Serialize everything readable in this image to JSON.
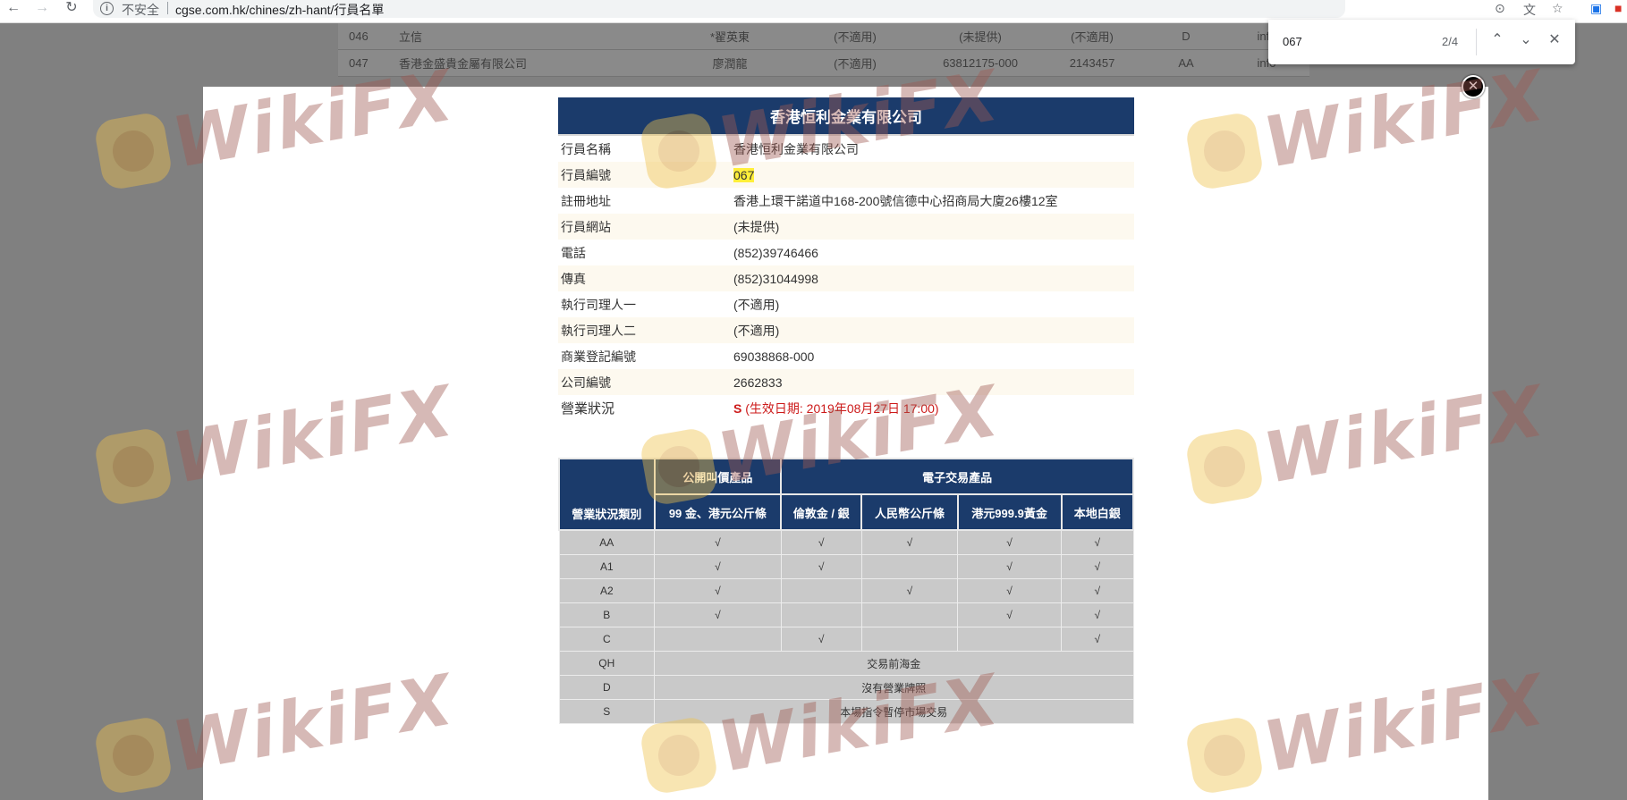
{
  "browser": {
    "security_label": "不安全",
    "url": "cgse.com.hk/chines/zh-hant/行員名單"
  },
  "background_rows": [
    {
      "no": "046",
      "name": "立信",
      "contact": "*翟英東",
      "c1": "(不適用)",
      "c2": "(未提供)",
      "c3": "(不適用)",
      "cat": "D",
      "link": "info"
    },
    {
      "no": "047",
      "name": "香港金盛貴金屬有限公司",
      "contact": "廖潤龍",
      "c1": "(不適用)",
      "c2": "63812175-000",
      "c3": "2143457",
      "cat": "AA",
      "link": "info"
    }
  ],
  "find_bar": {
    "query": "067",
    "count": "2/4"
  },
  "member": {
    "title": "香港恒利金業有限公司",
    "fields": [
      {
        "label": "行員名稱",
        "value": "香港恒利金業有限公司"
      },
      {
        "label": "行員編號",
        "value": "067"
      },
      {
        "label": "註冊地址",
        "value": "香港上環干諾道中168-200號信德中心招商局大廈26樓12室"
      },
      {
        "label": "行員網站",
        "value": "(未提供)"
      },
      {
        "label": "電話",
        "value": "(852)39746466"
      },
      {
        "label": "傳真",
        "value": "(852)31044998"
      },
      {
        "label": "執行司理人一",
        "value": "(不適用)"
      },
      {
        "label": "執行司理人二",
        "value": "(不適用)"
      },
      {
        "label": "商業登記編號",
        "value": "69038868-000"
      },
      {
        "label": "公司編號",
        "value": "2662833"
      }
    ],
    "status_label": "營業狀況",
    "status_code": "S",
    "status_detail": "(生效日期: 2019年08月27日 17:00)"
  },
  "category_table": {
    "group_open": "公開叫價產品",
    "group_electronic": "電子交易產品",
    "col_category": "營業狀況類別",
    "columns": [
      "99 金、港元公斤條",
      "倫敦金 / 銀",
      "人民幣公斤條",
      "港元999.9黃金",
      "本地白銀"
    ],
    "check": "√",
    "rows": [
      {
        "cat": "AA",
        "cells": [
          "√",
          "√",
          "√",
          "√",
          "√"
        ]
      },
      {
        "cat": "A1",
        "cells": [
          "√",
          "√",
          "",
          "√",
          "√"
        ]
      },
      {
        "cat": "A2",
        "cells": [
          "√",
          "",
          "√",
          "√",
          "√"
        ]
      },
      {
        "cat": "B",
        "cells": [
          "√",
          "",
          "",
          "√",
          "√"
        ]
      },
      {
        "cat": "C",
        "cells": [
          "",
          "√",
          "",
          "",
          "√"
        ]
      }
    ],
    "span_rows": [
      {
        "cat": "QH",
        "text": "交易前海金"
      },
      {
        "cat": "D",
        "text": "沒有營業牌照"
      },
      {
        "cat": "S",
        "text": "本場指令暫停市場交易"
      }
    ]
  },
  "watermark_text": "WikiFX",
  "colors": {
    "header_navy": "#1b3b6b",
    "status_red": "#cc1a1a",
    "highlight": "#ffef3a"
  }
}
